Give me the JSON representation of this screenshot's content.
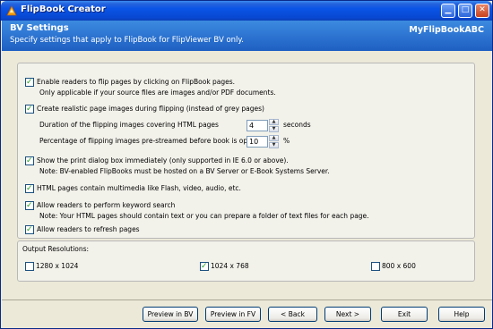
{
  "window": {
    "title": "FlipBook Creator"
  },
  "banner": {
    "title": "BV Settings",
    "subtitle": "Specify settings that apply to FlipBook for FlipViewer BV only.",
    "brand": "MyFlipBookABC"
  },
  "options": {
    "flip_click": {
      "label": "Enable readers to flip pages by clicking on FlipBook pages.",
      "note": "Only applicable if your source files are images and/or PDF documents.",
      "checked": true
    },
    "realistic": {
      "label": "Create realistic page images during flipping (instead of grey pages)",
      "checked": true
    },
    "duration": {
      "label": "Duration of the flipping images covering HTML pages",
      "value": "4",
      "unit": "seconds"
    },
    "prestream": {
      "label": "Percentage of flipping images pre-streamed before book is opened",
      "value": "10",
      "unit": "%"
    },
    "print": {
      "label": "Show the print dialog box immediately (only supported in IE 6.0 or above).",
      "note": "Note: BV-enabled FlipBooks must be hosted on a BV Server or E-Book Systems Server.",
      "checked": true
    },
    "multimedia": {
      "label": "HTML pages contain multimedia like Flash, video, audio, etc.",
      "checked": true
    },
    "keyword": {
      "label": "Allow readers to perform keyword search",
      "note": "Note: Your HTML pages should contain text or you can prepare a folder of text files for each page.",
      "checked": true
    },
    "refresh": {
      "label": "Allow readers to refresh pages",
      "checked": true
    }
  },
  "resolutions": {
    "title": "Output Resolutions:",
    "items": [
      {
        "label": "1280 x 1024",
        "checked": false
      },
      {
        "label": "1024 x 768",
        "checked": true
      },
      {
        "label": "800 x 600",
        "checked": false
      }
    ]
  },
  "buttons": {
    "preview_bv": "Preview in BV",
    "preview_fv": "Preview in FV",
    "back": "< Back",
    "next": "Next >",
    "exit": "Exit",
    "help": "Help"
  },
  "colors": {
    "titlebar": "#0a54e6",
    "banner": "#2f74d0",
    "check": "#21a121",
    "face": "#ece9d8"
  }
}
